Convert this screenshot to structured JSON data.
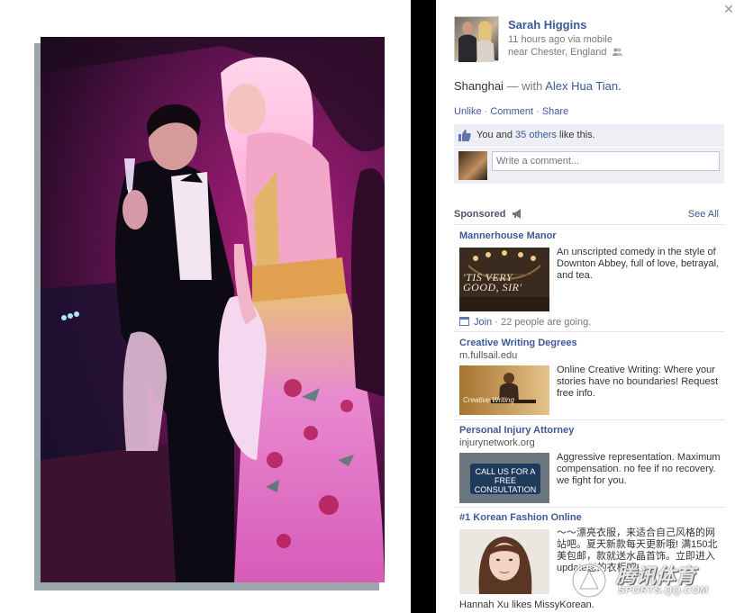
{
  "colors": {
    "link": "#3b5998",
    "panel_bg": "#edeff4",
    "divider": "#e5e5e5",
    "photo_dominant": "#b0207c"
  },
  "post": {
    "author_name": "Sarah Higgins",
    "time_via": "11 hours ago via mobile",
    "location": "near Chester, England",
    "caption_place": "Shanghai",
    "caption_with": " — with ",
    "caption_tagged": "Alex Hua Tian",
    "caption_end": "."
  },
  "actions": {
    "unlike": "Unlike",
    "comment": "Comment",
    "share": "Share",
    "separator": " · "
  },
  "likes": {
    "prefix": "You and ",
    "others_link": "35 others",
    "suffix": " like this."
  },
  "comment": {
    "placeholder": "Write a comment..."
  },
  "sponsored": {
    "label": "Sponsored",
    "see_all": "See All"
  },
  "ads": [
    {
      "title": "Mannerhouse Manor",
      "url": "",
      "image_text": "'TIS VERY GOOD, SIR'",
      "body": "An unscripted comedy in the style of Downton Abbey, full of love, betrayal, and tea.",
      "footer_link": "Join",
      "footer_text": " · 22 people are going."
    },
    {
      "title": "Creative Writing Degrees",
      "url": "m.fullsail.edu",
      "image_text": "Creative Writing",
      "body": "Online Creative Writing: Where your stories have no boundaries! Request free info."
    },
    {
      "title": "Personal Injury Attorney",
      "url": "injurynetwork.org",
      "image_text": "CALL US FOR A FREE CONSULTATION",
      "body": "Aggressive representation. Maximum compensation. no fee if no recovery. we fight for you."
    },
    {
      "title": "#1 Korean Fashion Online",
      "url": "",
      "body": "～～漂亮衣服，来适合自己风格的网站吧。夏天新款每天更新哦! 满150北美包邮，款就送水晶首饰。立即进入update您的衣柜吧!",
      "footer_text": "Hannah Xu likes MissyKorean."
    }
  ],
  "watermark": {
    "cn": "腾讯体育",
    "url": "SPORTS.QQ.COM"
  }
}
